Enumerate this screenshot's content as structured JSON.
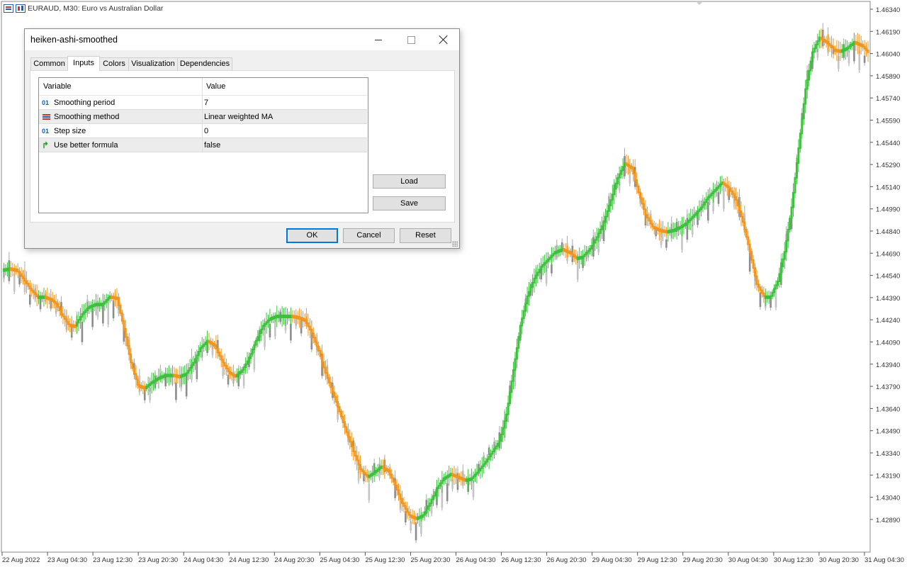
{
  "chart": {
    "title": "EURAUD, M30:  Euro vs Australian Dollar",
    "price_labels": [
      "1.46340",
      "1.46190",
      "1.46040",
      "1.45890",
      "1.45740",
      "1.45590",
      "1.45440",
      "1.45290",
      "1.45140",
      "1.44990",
      "1.44840",
      "1.44690",
      "1.44540",
      "1.44390",
      "1.44240",
      "1.44090",
      "1.43940",
      "1.43790",
      "1.43640",
      "1.43490",
      "1.43340",
      "1.43190",
      "1.43040",
      "1.42890"
    ],
    "time_labels": [
      "22 Aug 2022",
      "23 Aug 04:30",
      "23 Aug 12:30",
      "23 Aug 20:30",
      "24 Aug 04:30",
      "24 Aug 12:30",
      "24 Aug 20:30",
      "25 Aug 04:30",
      "25 Aug 12:30",
      "25 Aug 20:30",
      "26 Aug 04:30",
      "26 Aug 12:30",
      "26 Aug 20:30",
      "29 Aug 04:30",
      "29 Aug 12:30",
      "29 Aug 20:30",
      "30 Aug 04:30",
      "30 Aug 12:30",
      "30 Aug 20:30",
      "31 Aug 04:30"
    ],
    "colors": {
      "bull": "#3cc13c",
      "bear": "#f0961e",
      "raw": "#a8a8a8",
      "axis": "#555555"
    },
    "price_path": [
      [
        0,
        1.4458
      ],
      [
        4,
        1.4459
      ],
      [
        8,
        1.4458
      ],
      [
        12,
        1.4452
      ],
      [
        16,
        1.4445
      ],
      [
        20,
        1.444
      ],
      [
        24,
        1.444
      ],
      [
        28,
        1.4438
      ],
      [
        31,
        1.4435
      ],
      [
        34,
        1.4428
      ],
      [
        38,
        1.4421
      ],
      [
        42,
        1.442
      ],
      [
        46,
        1.4428
      ],
      [
        50,
        1.4433
      ],
      [
        54,
        1.4435
      ],
      [
        58,
        1.4435
      ],
      [
        62,
        1.444
      ],
      [
        66,
        1.4439
      ],
      [
        70,
        1.4418
      ],
      [
        74,
        1.4395
      ],
      [
        78,
        1.438
      ],
      [
        82,
        1.4378
      ],
      [
        86,
        1.4382
      ],
      [
        90,
        1.4385
      ],
      [
        94,
        1.4387
      ],
      [
        98,
        1.4387
      ],
      [
        102,
        1.4386
      ],
      [
        106,
        1.4388
      ],
      [
        110,
        1.4395
      ],
      [
        114,
        1.4405
      ],
      [
        118,
        1.441
      ],
      [
        122,
        1.4407
      ],
      [
        126,
        1.4397
      ],
      [
        130,
        1.4389
      ],
      [
        134,
        1.4386
      ],
      [
        138,
        1.439
      ],
      [
        142,
        1.4398
      ],
      [
        146,
        1.441
      ],
      [
        150,
        1.442
      ],
      [
        154,
        1.4425
      ],
      [
        158,
        1.4427
      ],
      [
        162,
        1.4427
      ],
      [
        166,
        1.4427
      ],
      [
        170,
        1.4426
      ],
      [
        174,
        1.4424
      ],
      [
        178,
        1.4415
      ],
      [
        182,
        1.4403
      ],
      [
        186,
        1.4388
      ],
      [
        190,
        1.4375
      ],
      [
        194,
        1.4362
      ],
      [
        198,
        1.4348
      ],
      [
        202,
        1.4335
      ],
      [
        206,
        1.4323
      ],
      [
        210,
        1.4318
      ],
      [
        214,
        1.4321
      ],
      [
        218,
        1.4325
      ],
      [
        222,
        1.4322
      ],
      [
        226,
        1.4312
      ],
      [
        230,
        1.43
      ],
      [
        234,
        1.4292
      ],
      [
        238,
        1.429
      ],
      [
        242,
        1.4292
      ],
      [
        246,
        1.43
      ],
      [
        250,
        1.431
      ],
      [
        254,
        1.4317
      ],
      [
        258,
        1.432
      ],
      [
        262,
        1.4318
      ],
      [
        266,
        1.4316
      ],
      [
        270,
        1.4317
      ],
      [
        274,
        1.4322
      ],
      [
        278,
        1.4328
      ],
      [
        282,
        1.4335
      ],
      [
        286,
        1.4342
      ],
      [
        290,
        1.436
      ],
      [
        294,
        1.439
      ],
      [
        298,
        1.442
      ],
      [
        302,
        1.444
      ],
      [
        306,
        1.4452
      ],
      [
        310,
        1.446
      ],
      [
        314,
        1.4465
      ],
      [
        318,
        1.447
      ],
      [
        322,
        1.4472
      ],
      [
        326,
        1.447
      ],
      [
        330,
        1.4466
      ],
      [
        334,
        1.4467
      ],
      [
        338,
        1.4472
      ],
      [
        342,
        1.448
      ],
      [
        346,
        1.449
      ],
      [
        350,
        1.4505
      ],
      [
        354,
        1.452
      ],
      [
        358,
        1.453
      ],
      [
        362,
        1.4527
      ],
      [
        366,
        1.451
      ],
      [
        370,
        1.4495
      ],
      [
        374,
        1.4487
      ],
      [
        378,
        1.4485
      ],
      [
        382,
        1.4484
      ],
      [
        386,
        1.4485
      ],
      [
        390,
        1.4487
      ],
      [
        394,
        1.449
      ],
      [
        398,
        1.4495
      ],
      [
        402,
        1.45
      ],
      [
        406,
        1.4507
      ],
      [
        410,
        1.4512
      ],
      [
        414,
        1.4517
      ],
      [
        418,
        1.4513
      ],
      [
        422,
        1.4505
      ],
      [
        426,
        1.449
      ],
      [
        430,
        1.447
      ],
      [
        434,
        1.4448
      ],
      [
        438,
        1.444
      ],
      [
        442,
        1.444
      ],
      [
        446,
        1.445
      ],
      [
        450,
        1.447
      ],
      [
        454,
        1.45
      ],
      [
        458,
        1.454
      ],
      [
        462,
        1.458
      ],
      [
        466,
        1.4605
      ],
      [
        470,
        1.4615
      ],
      [
        474,
        1.4612
      ],
      [
        478,
        1.4607
      ],
      [
        482,
        1.4606
      ],
      [
        486,
        1.4608
      ],
      [
        490,
        1.4612
      ],
      [
        494,
        1.461
      ],
      [
        498,
        1.4605
      ]
    ],
    "price_range": [
      1.4282,
      1.4637
    ]
  },
  "dialog": {
    "title": "heiken-ashi-smoothed",
    "tabs": [
      "Common",
      "Inputs",
      "Colors",
      "Visualization",
      "Dependencies"
    ],
    "active_tab": "Inputs",
    "columns": {
      "variable": "Variable",
      "value": "Value"
    },
    "rows": [
      {
        "icon": "int-param-icon",
        "icon_text": "01",
        "variable": "Smoothing period",
        "value": "7"
      },
      {
        "icon": "enum-param-icon",
        "icon_text": "",
        "variable": "Smoothing method",
        "value": "Linear weighted MA"
      },
      {
        "icon": "int-param-icon",
        "icon_text": "01",
        "variable": "Step size",
        "value": "0"
      },
      {
        "icon": "bool-param-icon",
        "icon_text": "↱",
        "variable": "Use better formula",
        "value": "false"
      }
    ],
    "buttons": {
      "load": "Load",
      "save": "Save",
      "ok": "OK",
      "cancel": "Cancel",
      "reset": "Reset"
    }
  }
}
